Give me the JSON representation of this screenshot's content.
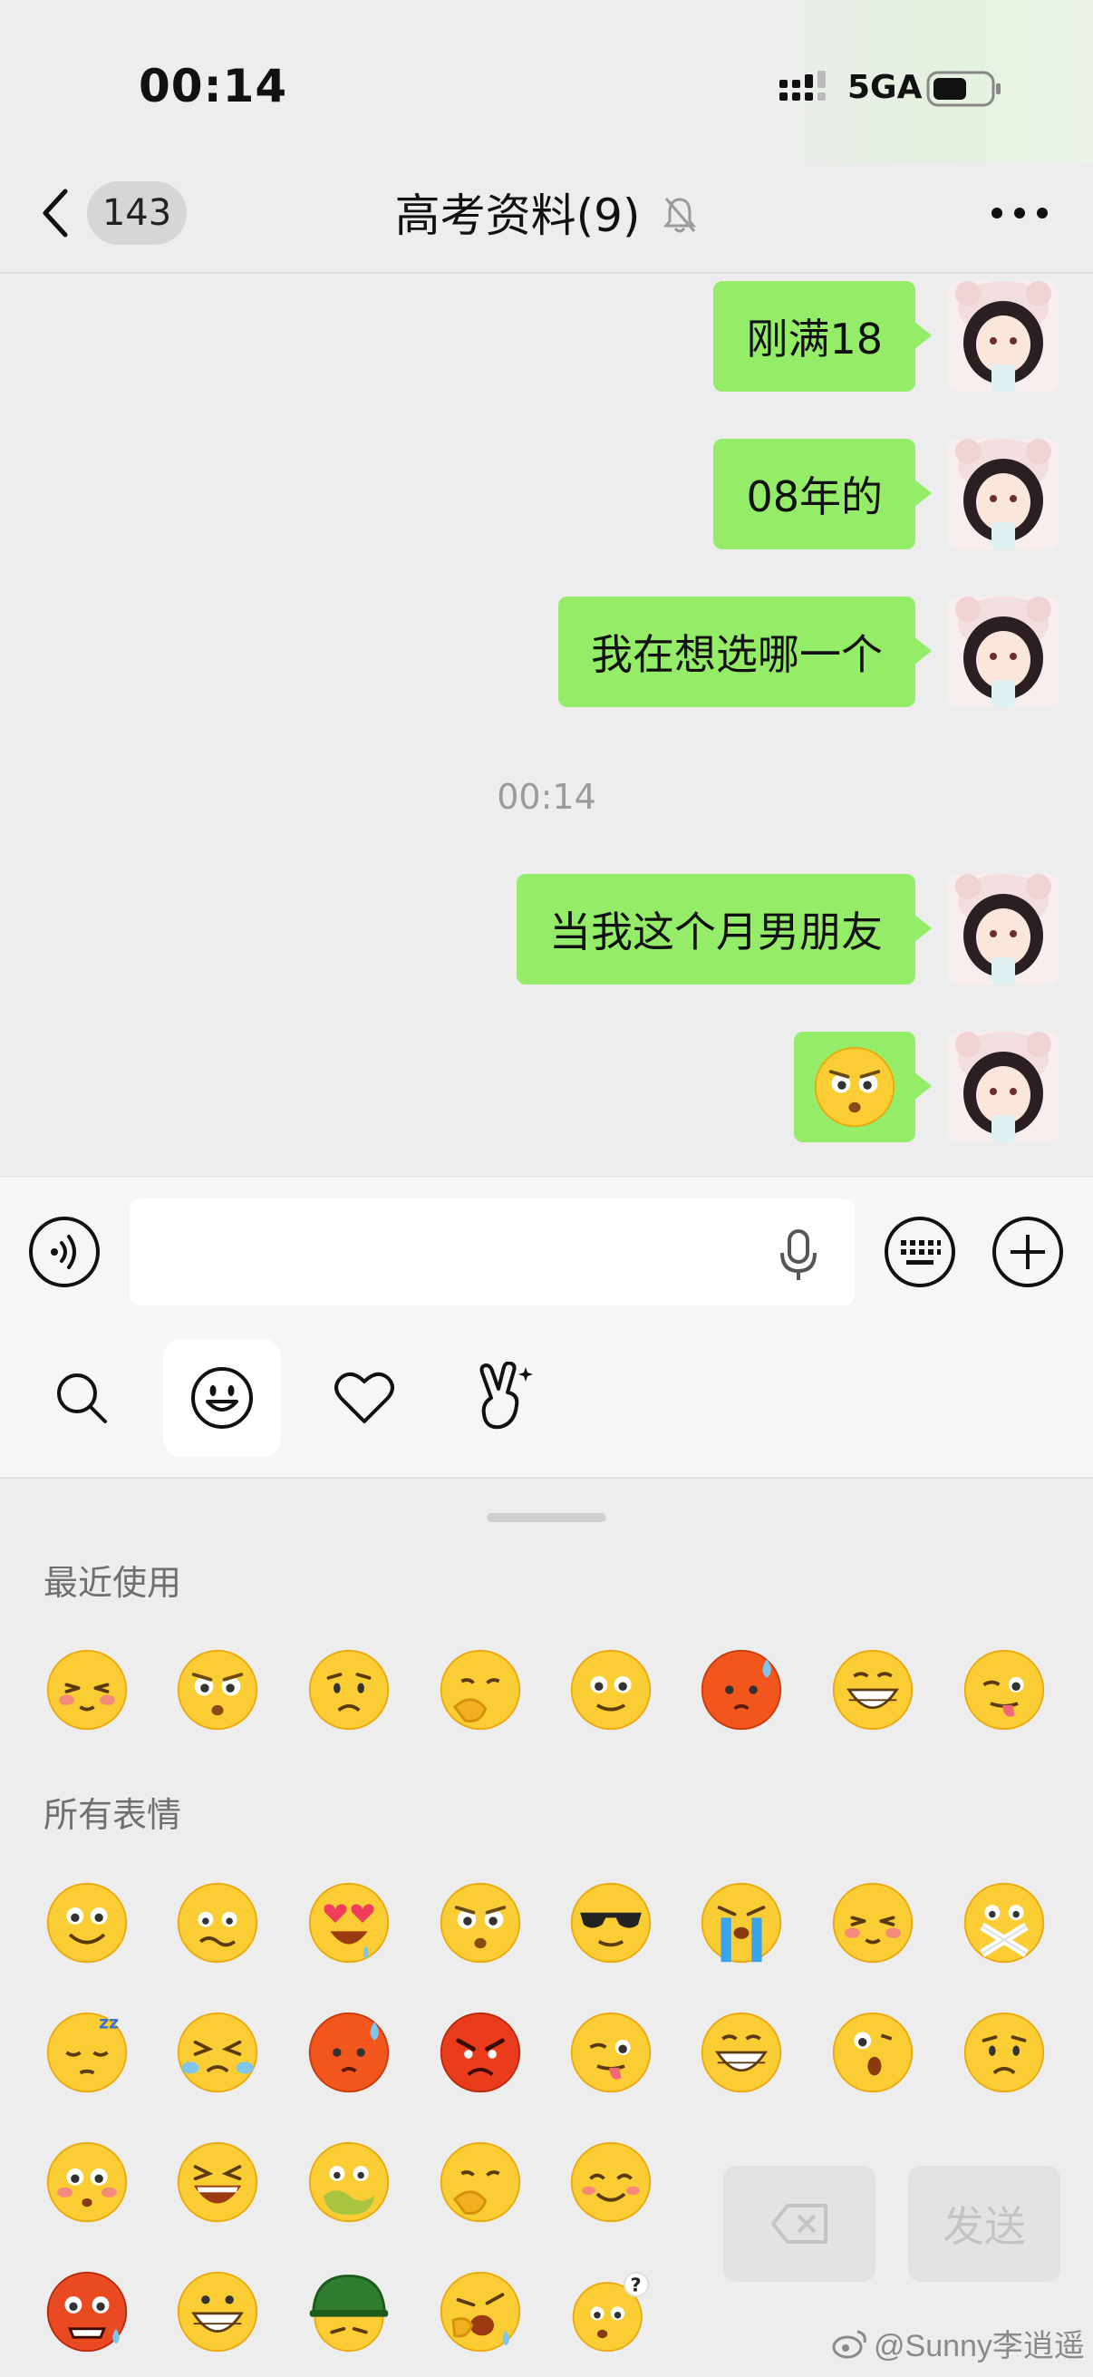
{
  "status_bar": {
    "time": "00:14",
    "network": "5GA",
    "battery_icon": "battery-icon"
  },
  "nav": {
    "back_icon": "chevron-left-icon",
    "unread_count": "143",
    "title": "高考资料(9)",
    "mute_icon": "bell-off-icon",
    "more_icon": "more-dots-icon"
  },
  "messages": [
    {
      "text": "刚满18"
    },
    {
      "text": "08年的"
    },
    {
      "text": "我在想选哪一个"
    },
    {
      "timestamp": "00:14"
    },
    {
      "text": "当我这个月男朋友"
    },
    {
      "emoji": "stare-face"
    }
  ],
  "input_bar": {
    "voice_icon": "voice-icon",
    "mic_icon": "mic-icon",
    "keyboard_icon": "keyboard-icon",
    "plus_icon": "plus-icon"
  },
  "tabs": [
    "search-icon",
    "smiley-icon",
    "heart-icon",
    "gesture-icon"
  ],
  "panel": {
    "recent_label": "最近使用",
    "all_label": "所有表情",
    "delete_icon": "backspace-icon",
    "send_label": "发送"
  },
  "watermark": "@Sunny李逍遥",
  "colors": {
    "bubble": "#95ec69",
    "background": "#ededed",
    "emoji_yellow": "#fbcd34"
  }
}
